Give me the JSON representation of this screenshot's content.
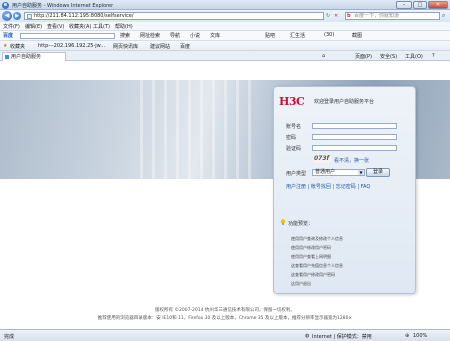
{
  "window": {
    "title": "用户自助服务 - Windows Internet Explorer",
    "min": "–",
    "max": "□",
    "close": "✕"
  },
  "address": {
    "url": "http://211.84.112.195:8080/selfservice/",
    "search_placeholder": "百度一下，你就知道"
  },
  "menu": [
    "文件(F)",
    "编辑(E)",
    "查看(V)",
    "收藏夹(A)",
    "工具(T)",
    "帮助(H)"
  ],
  "toolbar": {
    "items": [
      "搜索",
      "网址检索",
      "导航",
      "小说",
      "文库",
      "贴吧",
      "汇生活",
      "(30)",
      "截图"
    ],
    "brand": "百度"
  },
  "favorites": {
    "label": "收藏夹",
    "items": [
      "http---202.196.192.25-jw...",
      "网页快讯库",
      "建议网站",
      "百度"
    ]
  },
  "tab": {
    "label": "用户自助服务",
    "commands": [
      "页面(P)",
      "安全(S)",
      "工具(O)"
    ]
  },
  "login": {
    "logo": "H3C",
    "title": "欢迎登录用户自助服务平台",
    "account_label": "账号名",
    "password_label": "密码",
    "code_label": "验证码",
    "captcha": "073f",
    "refresh": "看不清，换一张",
    "usertype_label": "用户类型",
    "usertype_value": "普通用户",
    "login_button": "登录",
    "links": "用户注册 | 帐号找回 | 忘记密码 | FAQ"
  },
  "features": {
    "caption": "功能预览：",
    "items": [
      "使用用户查询及修改个人信息",
      "使用用户修改用户密码",
      "使用用户查看上网明细",
      "这查看用户充值信息个人信息",
      "这查看用户修改用户密码",
      "这用户退出"
    ]
  },
  "footer": {
    "line1": "版权所有 ©2007-2014 杭州华三通信技术有限公司，保留一切权利。",
    "line2": "推荐使用的浏览器目录版本：安 IE10和 11，Firefox 30 及以上版本，Chrome 35 及以上版本，推荐分辨率显示器宽为1280×"
  },
  "status": {
    "left": "完成",
    "zone": "Internet | 保护模式：禁用",
    "zoom": "100%"
  }
}
